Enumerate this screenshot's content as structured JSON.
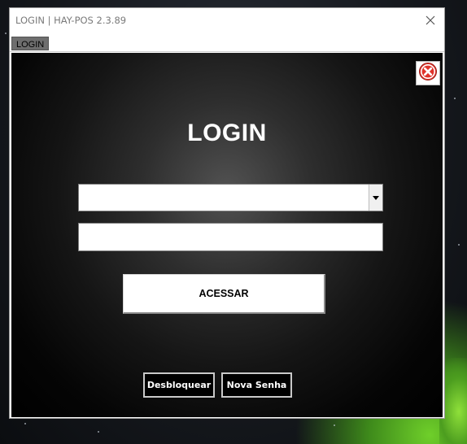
{
  "window": {
    "title": "LOGIN | HAY-POS 2.3.89"
  },
  "tabs": [
    {
      "label": "LOGIN",
      "selected": true
    }
  ],
  "panel": {
    "heading": "LOGIN",
    "user_select": {
      "value": ""
    },
    "password_field": {
      "value": ""
    },
    "submit_label": "ACESSAR",
    "unlock_label": "Desbloquear",
    "new_password_label": "Nova Senha"
  },
  "icons": {
    "window_close": "close-icon",
    "exit": "red-circle-x-icon",
    "dropdown": "chevron-down-icon"
  },
  "colors": {
    "exit_icon": "#e0332b",
    "panel_background": "#000000"
  }
}
